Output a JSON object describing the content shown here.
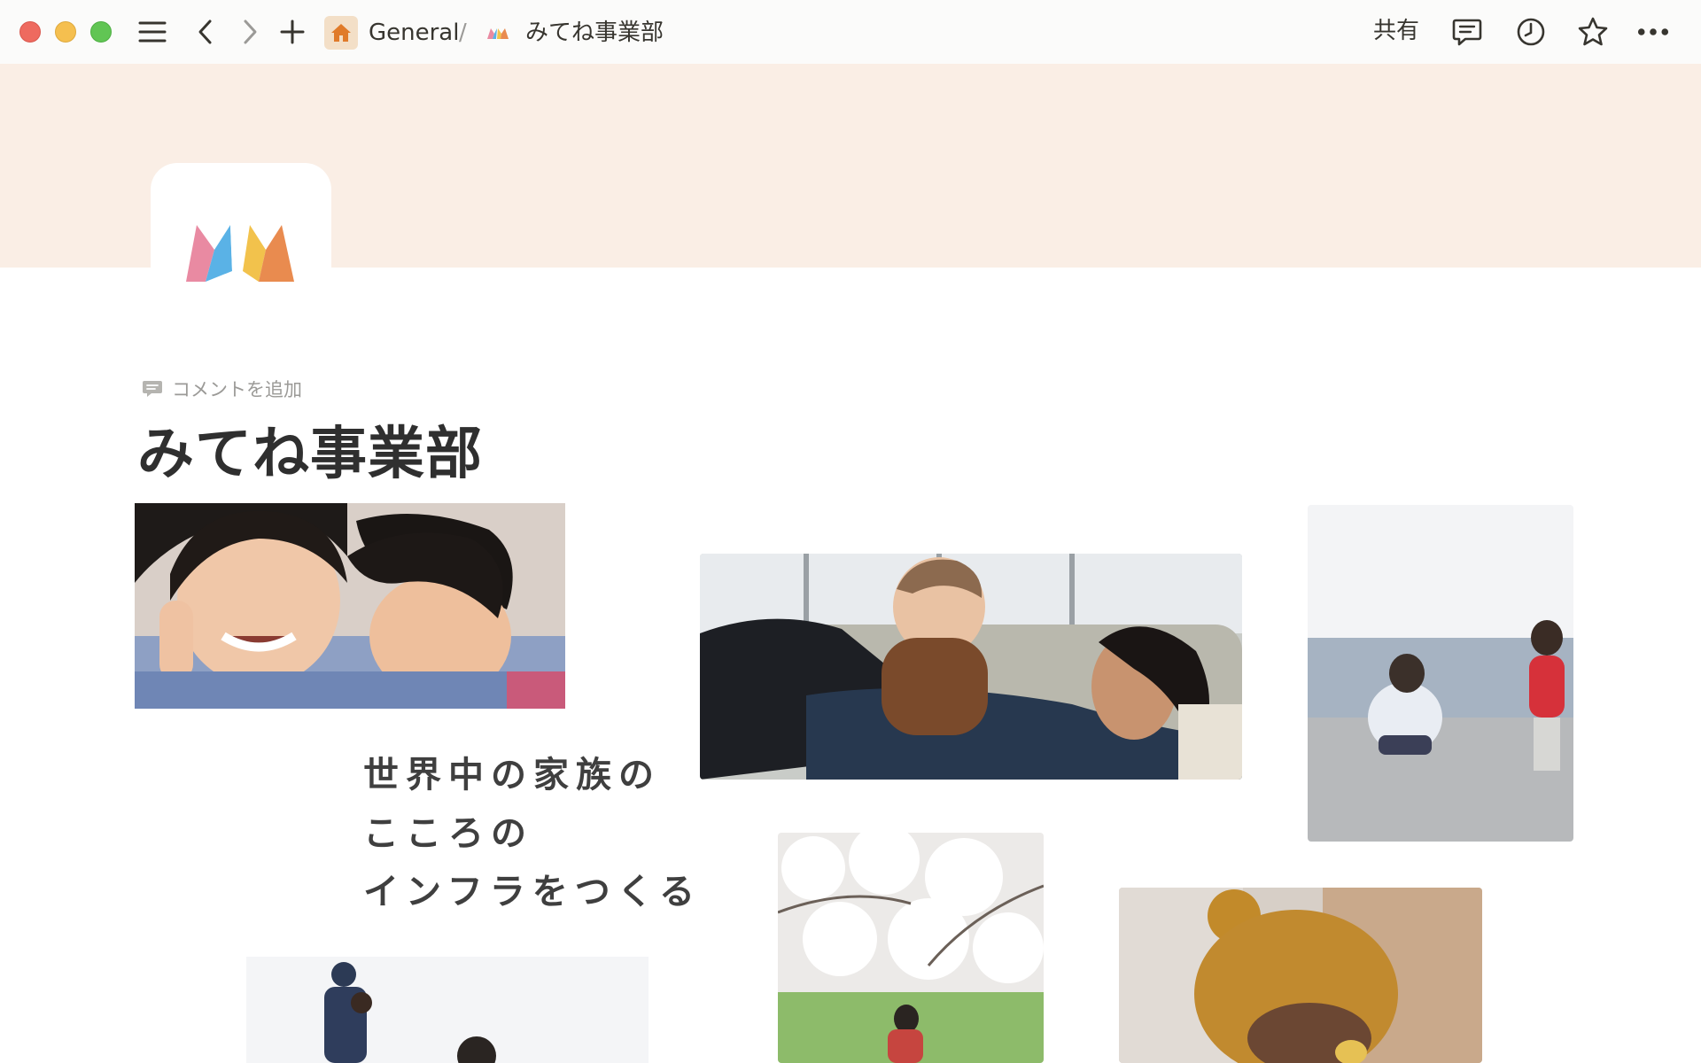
{
  "window": {
    "controls": [
      "close",
      "minimize",
      "zoom"
    ]
  },
  "toolbar": {
    "icons": [
      "menu-icon",
      "back-icon",
      "forward-icon",
      "plus-icon"
    ],
    "breadcrumb": {
      "workspace": "General",
      "separator": "/",
      "page": "みてね事業部"
    },
    "share_label": "共有",
    "right_icons": [
      "comments-icon",
      "history-icon",
      "favorite-icon",
      "more-icon"
    ]
  },
  "cover": {
    "color": "#faeee5"
  },
  "page": {
    "add_comment": "コメントを追加",
    "title": "みてね事業部",
    "logo_colors": [
      "#e98aa2",
      "#5ab2e6",
      "#f2c24c",
      "#e98b4f"
    ]
  },
  "content": {
    "tagline": [
      "世界中の家族の",
      "こころの",
      "インフラをつくる"
    ],
    "photos": [
      "children-lying-photo",
      "mother-baby-couch-photo",
      "kids-beach-photo",
      "cherry-blossom-photo",
      "newborn-knit-hat-photo",
      "father-walking-photo"
    ]
  }
}
